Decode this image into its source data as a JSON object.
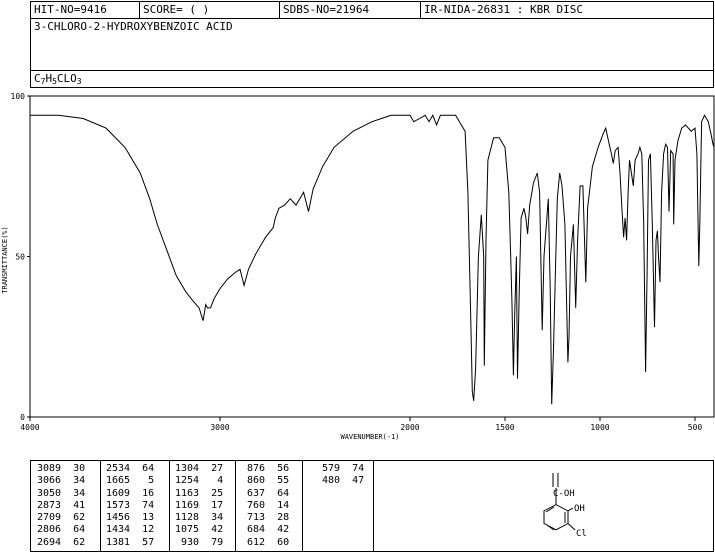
{
  "header": {
    "hit_no": "HIT-NO=9416",
    "score": "SCORE=  (   )",
    "sdbs_no": "SDBS-NO=21964",
    "ir_info": "IR-NIDA-26831 : KBR DISC"
  },
  "compound": {
    "name": "3-CHLORO-2-HYDROXYBENZOIC ACID",
    "formula_parts": [
      "C",
      "7",
      "H",
      "5",
      "CLO",
      "3"
    ]
  },
  "chart_data": {
    "type": "line",
    "xlabel": "WAVENUMBER(-1)",
    "ylabel": "TRANSMITTANCE(%)",
    "xlim": [
      4000,
      400
    ],
    "ylim": [
      0,
      100
    ],
    "x_ticks": [
      4000,
      3000,
      2000,
      1500,
      1000,
      500
    ],
    "y_ticks": [
      100,
      50,
      0
    ],
    "spectrum": [
      [
        4000,
        94
      ],
      [
        3850,
        94
      ],
      [
        3720,
        93
      ],
      [
        3600,
        90
      ],
      [
        3500,
        84
      ],
      [
        3420,
        76
      ],
      [
        3370,
        68
      ],
      [
        3330,
        60
      ],
      [
        3280,
        52
      ],
      [
        3230,
        44
      ],
      [
        3180,
        39
      ],
      [
        3140,
        36
      ],
      [
        3110,
        34
      ],
      [
        3089,
        30
      ],
      [
        3075,
        35
      ],
      [
        3066,
        34
      ],
      [
        3050,
        34
      ],
      [
        3030,
        37
      ],
      [
        3000,
        40
      ],
      [
        2960,
        43
      ],
      [
        2920,
        45
      ],
      [
        2895,
        46
      ],
      [
        2873,
        41
      ],
      [
        2850,
        46
      ],
      [
        2810,
        51
      ],
      [
        2760,
        56
      ],
      [
        2720,
        59
      ],
      [
        2709,
        62
      ],
      [
        2690,
        65
      ],
      [
        2660,
        66
      ],
      [
        2630,
        68
      ],
      [
        2600,
        66
      ],
      [
        2560,
        70
      ],
      [
        2534,
        64
      ],
      [
        2510,
        71
      ],
      [
        2460,
        78
      ],
      [
        2400,
        84
      ],
      [
        2300,
        89
      ],
      [
        2200,
        92
      ],
      [
        2100,
        94
      ],
      [
        2050,
        94
      ],
      [
        2000,
        94
      ],
      [
        1980,
        92
      ],
      [
        1950,
        93
      ],
      [
        1920,
        94
      ],
      [
        1900,
        92
      ],
      [
        1880,
        94
      ],
      [
        1860,
        91
      ],
      [
        1840,
        94
      ],
      [
        1800,
        94
      ],
      [
        1760,
        94
      ],
      [
        1740,
        92
      ],
      [
        1710,
        89
      ],
      [
        1695,
        70
      ],
      [
        1680,
        30
      ],
      [
        1672,
        8
      ],
      [
        1665,
        5
      ],
      [
        1655,
        15
      ],
      [
        1640,
        50
      ],
      [
        1625,
        63
      ],
      [
        1612,
        50
      ],
      [
        1609,
        16
      ],
      [
        1600,
        55
      ],
      [
        1590,
        80
      ],
      [
        1560,
        87
      ],
      [
        1530,
        87
      ],
      [
        1500,
        84
      ],
      [
        1480,
        70
      ],
      [
        1470,
        50
      ],
      [
        1463,
        35
      ],
      [
        1456,
        13
      ],
      [
        1449,
        32
      ],
      [
        1440,
        50
      ],
      [
        1434,
        12
      ],
      [
        1425,
        40
      ],
      [
        1415,
        62
      ],
      [
        1400,
        65
      ],
      [
        1390,
        62
      ],
      [
        1381,
        57
      ],
      [
        1370,
        66
      ],
      [
        1350,
        73
      ],
      [
        1330,
        76
      ],
      [
        1318,
        70
      ],
      [
        1304,
        27
      ],
      [
        1295,
        50
      ],
      [
        1285,
        58
      ],
      [
        1272,
        68
      ],
      [
        1262,
        40
      ],
      [
        1254,
        4
      ],
      [
        1245,
        20
      ],
      [
        1235,
        45
      ],
      [
        1225,
        68
      ],
      [
        1212,
        76
      ],
      [
        1200,
        72
      ],
      [
        1185,
        60
      ],
      [
        1169,
        17
      ],
      [
        1163,
        25
      ],
      [
        1155,
        50
      ],
      [
        1140,
        60
      ],
      [
        1128,
        34
      ],
      [
        1118,
        55
      ],
      [
        1105,
        72
      ],
      [
        1090,
        72
      ],
      [
        1075,
        42
      ],
      [
        1065,
        65
      ],
      [
        1040,
        78
      ],
      [
        1010,
        84
      ],
      [
        985,
        88
      ],
      [
        970,
        90
      ],
      [
        955,
        86
      ],
      [
        940,
        82
      ],
      [
        930,
        79
      ],
      [
        920,
        83
      ],
      [
        905,
        84
      ],
      [
        895,
        76
      ],
      [
        885,
        65
      ],
      [
        876,
        56
      ],
      [
        868,
        62
      ],
      [
        860,
        55
      ],
      [
        852,
        70
      ],
      [
        845,
        80
      ],
      [
        835,
        76
      ],
      [
        825,
        72
      ],
      [
        815,
        80
      ],
      [
        800,
        82
      ],
      [
        790,
        84
      ],
      [
        780,
        82
      ],
      [
        770,
        60
      ],
      [
        760,
        14
      ],
      [
        752,
        45
      ],
      [
        745,
        80
      ],
      [
        735,
        82
      ],
      [
        725,
        60
      ],
      [
        713,
        28
      ],
      [
        705,
        55
      ],
      [
        698,
        58
      ],
      [
        692,
        50
      ],
      [
        684,
        42
      ],
      [
        676,
        70
      ],
      [
        665,
        82
      ],
      [
        655,
        85
      ],
      [
        645,
        84
      ],
      [
        637,
        64
      ],
      [
        628,
        83
      ],
      [
        615,
        82
      ],
      [
        612,
        60
      ],
      [
        605,
        80
      ],
      [
        590,
        86
      ],
      [
        570,
        90
      ],
      [
        550,
        91
      ],
      [
        520,
        89
      ],
      [
        500,
        90
      ],
      [
        490,
        82
      ],
      [
        480,
        47
      ],
      [
        475,
        60
      ],
      [
        465,
        92
      ],
      [
        450,
        94
      ],
      [
        430,
        92
      ],
      [
        415,
        88
      ],
      [
        405,
        85
      ],
      [
        400,
        84
      ]
    ],
    "peak_table": [
      [
        [
          "3089",
          "30"
        ],
        [
          "3066",
          "34"
        ],
        [
          "3050",
          "34"
        ],
        [
          "2873",
          "41"
        ],
        [
          "2709",
          "62"
        ],
        [
          "2806",
          "64"
        ],
        [
          "2694",
          "62"
        ]
      ],
      [
        [
          "2534",
          "64"
        ],
        [
          "1665",
          "5"
        ],
        [
          "1609",
          "16"
        ],
        [
          "1573",
          "74"
        ],
        [
          "1456",
          "13"
        ],
        [
          "1434",
          "12"
        ],
        [
          "1381",
          "57"
        ]
      ],
      [
        [
          "1304",
          "27"
        ],
        [
          "1254",
          "4"
        ],
        [
          "1163",
          "25"
        ],
        [
          "1169",
          "17"
        ],
        [
          "1128",
          "34"
        ],
        [
          "1075",
          "42"
        ],
        [
          "930",
          "79"
        ]
      ],
      [
        [
          "876",
          "56"
        ],
        [
          "860",
          "55"
        ],
        [
          "637",
          "64"
        ],
        [
          "760",
          "14"
        ],
        [
          "713",
          "28"
        ],
        [
          "684",
          "42"
        ],
        [
          "612",
          "60"
        ]
      ],
      [
        [
          "579",
          "74"
        ],
        [
          "480",
          "47"
        ]
      ]
    ]
  },
  "structure": {
    "cooh_label": "C-OH",
    "oh_label": "OH",
    "cl_label": "Cl"
  }
}
